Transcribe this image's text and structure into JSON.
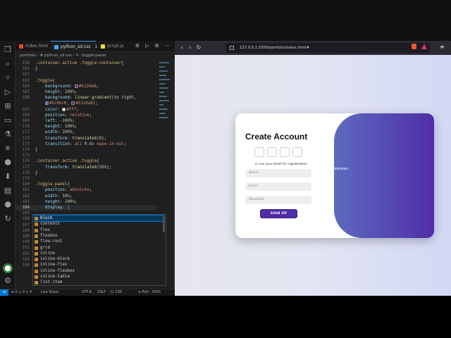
{
  "vscode": {
    "tabs": [
      {
        "label": "index.html",
        "icon_color": "#e44d26"
      },
      {
        "label": "python_sd.css",
        "icon_color": "#42a5f5",
        "close": "1"
      },
      {
        "label": "script.js",
        "icon_color": "#f1dd35"
      }
    ],
    "tab_actions": "⚙ ▷ ⊞ ⋯",
    "breadcrumb": "portfolio › # python_sd.css › ✎ .toggle-panel",
    "code_lines": [
      {
        "n": "158",
        "parts": [
          [
            "sel",
            ".container.active .toggle-container"
          ],
          [
            "pun",
            "{"
          ]
        ]
      },
      {
        "n": "161",
        "parts": [
          [
            "pun",
            "}"
          ]
        ]
      },
      {
        "n": "162",
        "parts": []
      },
      {
        "n": "163",
        "parts": [
          [
            "sel",
            ".toggle"
          ],
          [
            "pun",
            "{"
          ]
        ]
      },
      {
        "n": "164",
        "parts": [
          [
            "prop",
            "    background"
          ],
          [
            "pun",
            ": "
          ],
          [
            "swatch",
            "#512da8"
          ],
          [
            "val",
            "#512da8"
          ],
          [
            "pun",
            ";"
          ]
        ]
      },
      {
        "n": "165",
        "parts": [
          [
            "prop",
            "    height"
          ],
          [
            "pun",
            ": "
          ],
          [
            "num",
            "100%"
          ],
          [
            "pun",
            ";"
          ]
        ]
      },
      {
        "n": "166",
        "parts": [
          [
            "prop",
            "    background"
          ],
          [
            "pun",
            ": "
          ],
          [
            "fn",
            "linear-gradient"
          ],
          [
            "pun",
            "(to right,"
          ]
        ]
      },
      {
        "n": "",
        "parts": [
          [
            "pun",
            "    "
          ],
          [
            "swatch",
            "#5c6bc0"
          ],
          [
            "val",
            "#5c6bc0"
          ],
          [
            "pun",
            ", "
          ],
          [
            "swatch",
            "#512da8"
          ],
          [
            "val",
            "#512da8"
          ],
          [
            "pun",
            ");"
          ]
        ]
      },
      {
        "n": "167",
        "parts": [
          [
            "prop",
            "    color"
          ],
          [
            "pun",
            ": "
          ],
          [
            "swatch",
            "#ffffff"
          ],
          [
            "val",
            "#fff"
          ],
          [
            "pun",
            ";"
          ]
        ]
      },
      {
        "n": "168",
        "parts": [
          [
            "prop",
            "    position"
          ],
          [
            "pun",
            ": "
          ],
          [
            "val",
            "relative"
          ],
          [
            "pun",
            ";"
          ]
        ]
      },
      {
        "n": "169",
        "parts": [
          [
            "prop",
            "    left"
          ],
          [
            "pun",
            ": "
          ],
          [
            "num",
            "-100%"
          ],
          [
            "pun",
            ";"
          ]
        ]
      },
      {
        "n": "170",
        "parts": [
          [
            "prop",
            "    height"
          ],
          [
            "pun",
            ": "
          ],
          [
            "num",
            "100%"
          ],
          [
            "pun",
            ";"
          ]
        ]
      },
      {
        "n": "171",
        "parts": [
          [
            "prop",
            "    width"
          ],
          [
            "pun",
            ": "
          ],
          [
            "num",
            "200%"
          ],
          [
            "pun",
            ";"
          ]
        ]
      },
      {
        "n": "172",
        "parts": [
          [
            "prop",
            "    transform"
          ],
          [
            "pun",
            ": "
          ],
          [
            "fn",
            "translateX"
          ],
          [
            "pun",
            "("
          ],
          [
            "num",
            "0"
          ],
          [
            "pun",
            ");"
          ]
        ]
      },
      {
        "n": "173",
        "parts": [
          [
            "prop",
            "    transition"
          ],
          [
            "pun",
            ": "
          ],
          [
            "val",
            "all "
          ],
          [
            "num",
            "0.6s"
          ],
          [
            "val",
            " ease-in-out"
          ],
          [
            "pun",
            ";"
          ]
        ]
      },
      {
        "n": "174",
        "parts": [
          [
            "pun",
            "}"
          ]
        ]
      },
      {
        "n": "175",
        "parts": []
      },
      {
        "n": "176",
        "parts": [
          [
            "sel",
            ".container.active .toggle"
          ],
          [
            "pun",
            "{"
          ]
        ]
      },
      {
        "n": "177",
        "parts": [
          [
            "prop",
            "    transform"
          ],
          [
            "pun",
            ": "
          ],
          [
            "fn",
            "translateX"
          ],
          [
            "pun",
            "("
          ],
          [
            "num",
            "50%"
          ],
          [
            "pun",
            ");"
          ]
        ]
      },
      {
        "n": "178",
        "parts": [
          [
            "pun",
            "}"
          ]
        ]
      },
      {
        "n": "179",
        "parts": []
      },
      {
        "n": "180",
        "parts": [
          [
            "sel",
            ".toggle-panel"
          ],
          [
            "pun",
            "{"
          ]
        ]
      },
      {
        "n": "181",
        "parts": [
          [
            "prop",
            "    position"
          ],
          [
            "pun",
            ": "
          ],
          [
            "val",
            "absolute"
          ],
          [
            "pun",
            ";"
          ]
        ]
      },
      {
        "n": "182",
        "parts": [
          [
            "prop",
            "    width"
          ],
          [
            "pun",
            ": "
          ],
          [
            "num",
            "50%"
          ],
          [
            "pun",
            ";"
          ]
        ]
      },
      {
        "n": "183",
        "parts": [
          [
            "prop",
            "    height"
          ],
          [
            "pun",
            ": "
          ],
          [
            "num",
            "100%"
          ],
          [
            "pun",
            ";"
          ]
        ]
      },
      {
        "n": "184",
        "current": true,
        "parts": [
          [
            "prop",
            "    display"
          ],
          [
            "pun",
            ": "
          ],
          [
            "pun",
            "|"
          ]
        ]
      },
      {
        "n": "185",
        "parts": []
      },
      {
        "n": "186",
        "parts": []
      },
      {
        "n": "187",
        "parts": []
      },
      {
        "n": "188",
        "parts": []
      },
      {
        "n": "189",
        "parts": []
      },
      {
        "n": "190",
        "parts": []
      },
      {
        "n": "191",
        "parts": []
      },
      {
        "n": "192",
        "parts": []
      },
      {
        "n": "193",
        "parts": []
      },
      {
        "n": "194",
        "parts": []
      }
    ],
    "suggestions": [
      "block",
      "contents",
      "flex",
      "flexbox",
      "flow-root",
      "grid",
      "inline",
      "inline-block",
      "inline-flex",
      "inline-flexbox",
      "inline-table",
      "list-item"
    ],
    "status": {
      "left": "⊗ 0 ⚠ 0  ⊙ 0",
      "live": "Live Share",
      "encoding": "UTF-8",
      "eol": "CRLF",
      "lang": "{} CSS",
      "port": "⊘ Port : 5500"
    }
  },
  "browser": {
    "url": "127.0.0.1:5500/portfolio/index.html#",
    "card": {
      "title": "Create Account",
      "or_text": "or use your email for registeration",
      "name_placeholder": "Name",
      "email_placeholder": "Email",
      "password_placeholder": "Password",
      "signup_label": "SIGN UP",
      "panel_text": "e features.",
      "accent": "#512da8",
      "gradient_start": "#5c6bc0"
    }
  }
}
